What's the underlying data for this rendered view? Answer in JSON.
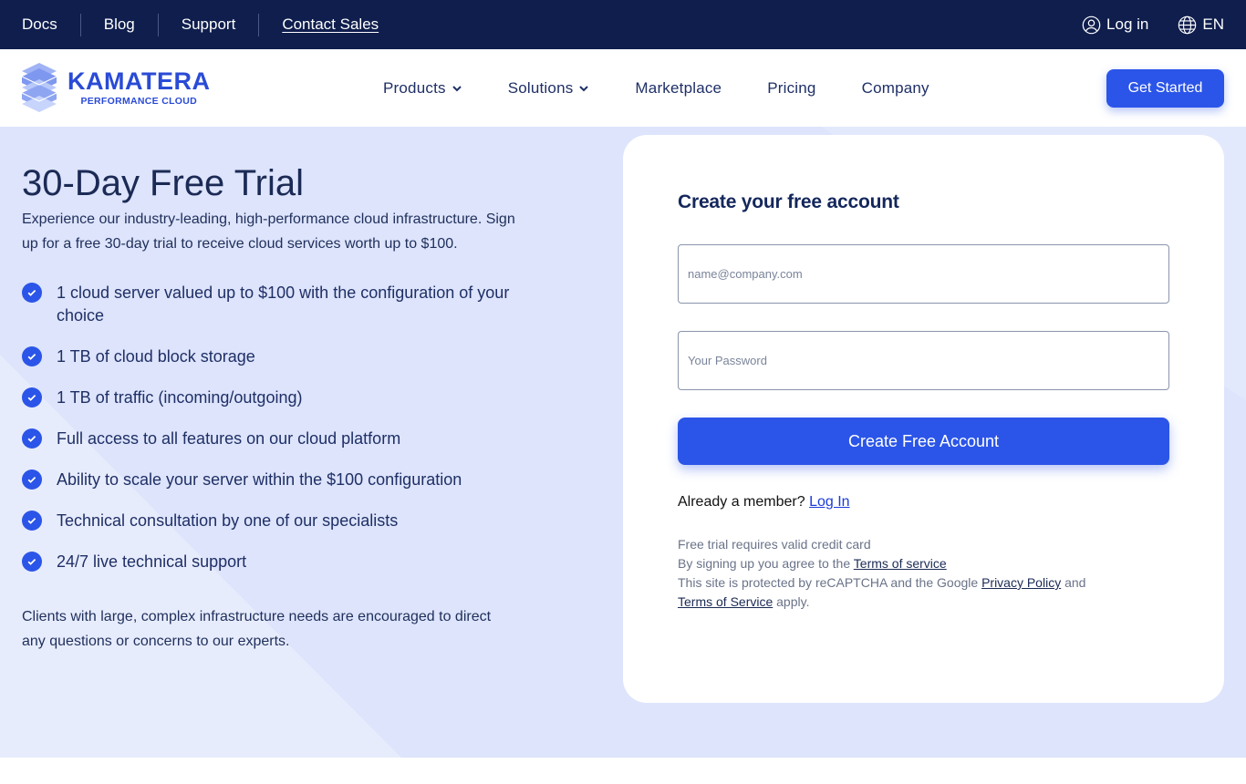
{
  "topbar": {
    "links": [
      "Docs",
      "Blog",
      "Support",
      "Contact Sales"
    ],
    "login_label": "Log in",
    "language": "EN"
  },
  "header": {
    "logo_main": "KAMATERA",
    "logo_sub": "PERFORMANCE CLOUD",
    "nav": [
      "Products",
      "Solutions",
      "Marketplace",
      "Pricing",
      "Company"
    ],
    "cta": "Get Started"
  },
  "hero": {
    "title": "30-Day Free Trial",
    "intro": "Experience our industry-leading, high-performance cloud infrastructure. Sign up for a free 30-day trial to receive cloud services worth up to $100.",
    "features": [
      "1 cloud server valued up to $100 with the configuration of your choice",
      "1 TB of cloud block storage",
      "1 TB of traffic (incoming/outgoing)",
      "Full access to all features on our cloud platform",
      "Ability to scale your server within the $100 configuration",
      "Technical consultation by one of our specialists",
      "24/7 live technical support"
    ],
    "outro": "Clients with large, complex infrastructure needs are encouraged to direct any questions or concerns to our experts."
  },
  "signup": {
    "title": "Create your free account",
    "email_placeholder": "name@company.com",
    "password_placeholder": "Your Password",
    "submit": "Create Free Account",
    "member_text": "Already a member?",
    "login_link": "Log In",
    "fine_line1": "Free trial requires valid credit card",
    "fine_line2_prefix": "By signing up you agree to the",
    "terms_link": "Terms of service",
    "fine_line3_prefix": "This site is protected by reCAPTCHA and the Google",
    "privacy_link": "Privacy Policy",
    "fine_line3_and": "and",
    "terms_link2": "Terms of Service",
    "fine_line3_suffix": "apply."
  },
  "colors": {
    "topbar_bg": "#0f1e4d",
    "brand_blue": "#2b55e8",
    "hero_bg": "#dde4fb",
    "heading": "#1b2a55"
  },
  "icons": {
    "user": "user-circle-icon",
    "globe": "globe-icon",
    "chevron": "chevron-down-icon",
    "check": "check-circle-icon"
  }
}
